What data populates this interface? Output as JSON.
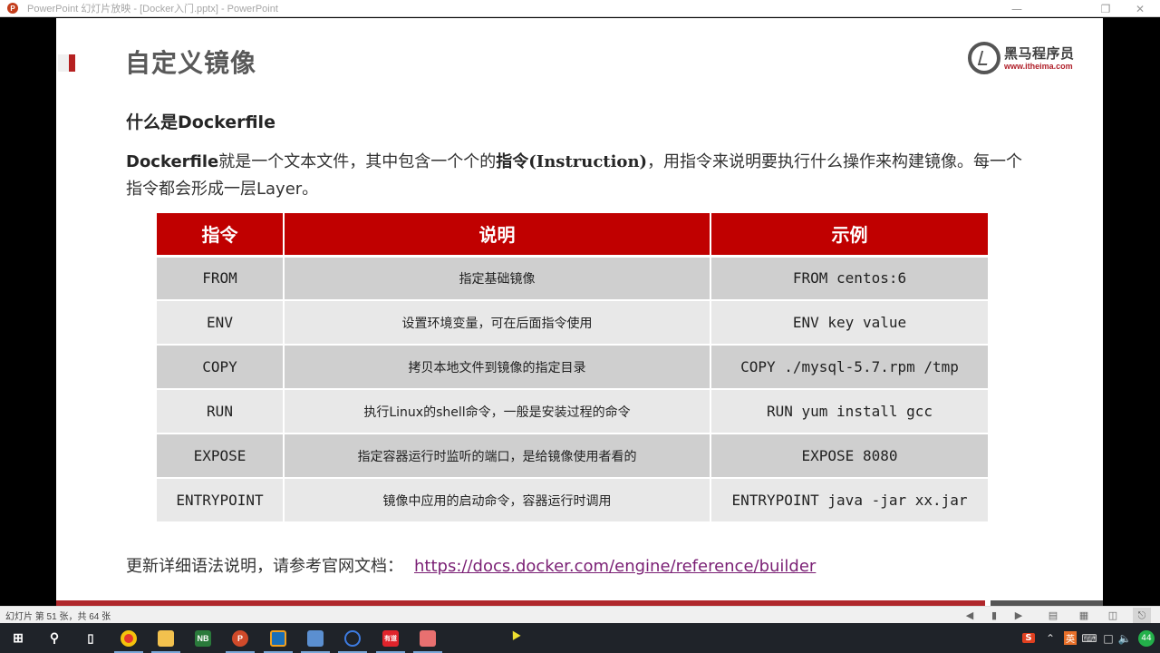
{
  "window": {
    "title": "PowerPoint 幻灯片放映 - [Docker入门.pptx] - PowerPoint",
    "minimize_icon": "minimize-icon",
    "restore_icon": "restore-icon",
    "close_icon": "close-icon"
  },
  "slide": {
    "title": "自定义镜像",
    "logo": {
      "name": "黑马程序员",
      "url": "www.itheima.com"
    },
    "subheading": "什么是Dockerfile",
    "paragraph": {
      "part1_bold": "Dockerfile",
      "part2": "就是一个文本文件，其中包含一个个的",
      "part3_bold": "指令",
      "part4_bold_serif": "(Instruction)",
      "part5": "，用指令来说明要执行什么操作来构建镜像。每一个指令都会形成一层Layer。"
    },
    "table": {
      "headers": [
        "指令",
        "说明",
        "示例"
      ],
      "rows": [
        {
          "instruction": "FROM",
          "description": "指定基础镜像",
          "example": "FROM centos:6"
        },
        {
          "instruction": "ENV",
          "description": "设置环境变量，可在后面指令使用",
          "example": "ENV key value"
        },
        {
          "instruction": "COPY",
          "description": "拷贝本地文件到镜像的指定目录",
          "example": "COPY ./mysql-5.7.rpm /tmp"
        },
        {
          "instruction": "RUN",
          "description": "执行Linux的shell命令，一般是安装过程的命令",
          "example": "RUN yum install gcc"
        },
        {
          "instruction": "EXPOSE",
          "description": "指定容器运行时监听的端口，是给镜像使用者看的",
          "example": "EXPOSE 8080"
        },
        {
          "instruction": "ENTRYPOINT",
          "description": "镜像中应用的启动命令，容器运行时调用",
          "example": "ENTRYPOINT java -jar xx.jar"
        }
      ]
    },
    "footer": {
      "text": "更新详细语法说明，请参考官网文档：",
      "link": "https://docs.docker.com/engine/reference/builder"
    },
    "colors": {
      "accent": "#c00000",
      "link": "#7a1f74",
      "row_dark": "#cfcfcf",
      "row_light": "#e8e8e8"
    }
  },
  "statusbar": {
    "slide_count": "幻灯片 第 51 张，共 64 张",
    "buttons": [
      "previous-icon",
      "menu-icon",
      "next-icon",
      "normal-view-icon",
      "slide-sorter-icon",
      "reading-view-icon",
      "slideshow-icon"
    ]
  },
  "taskbar": {
    "apps": [
      "Start",
      "Search",
      "Task View",
      "Chrome",
      "File Explorer",
      "NetBeans",
      "PowerPoint",
      "VirtualBox",
      "Remote Desktop",
      "Sourcetree",
      "有道",
      "Typora"
    ],
    "tray": {
      "ime": "英",
      "badge": "44"
    }
  }
}
